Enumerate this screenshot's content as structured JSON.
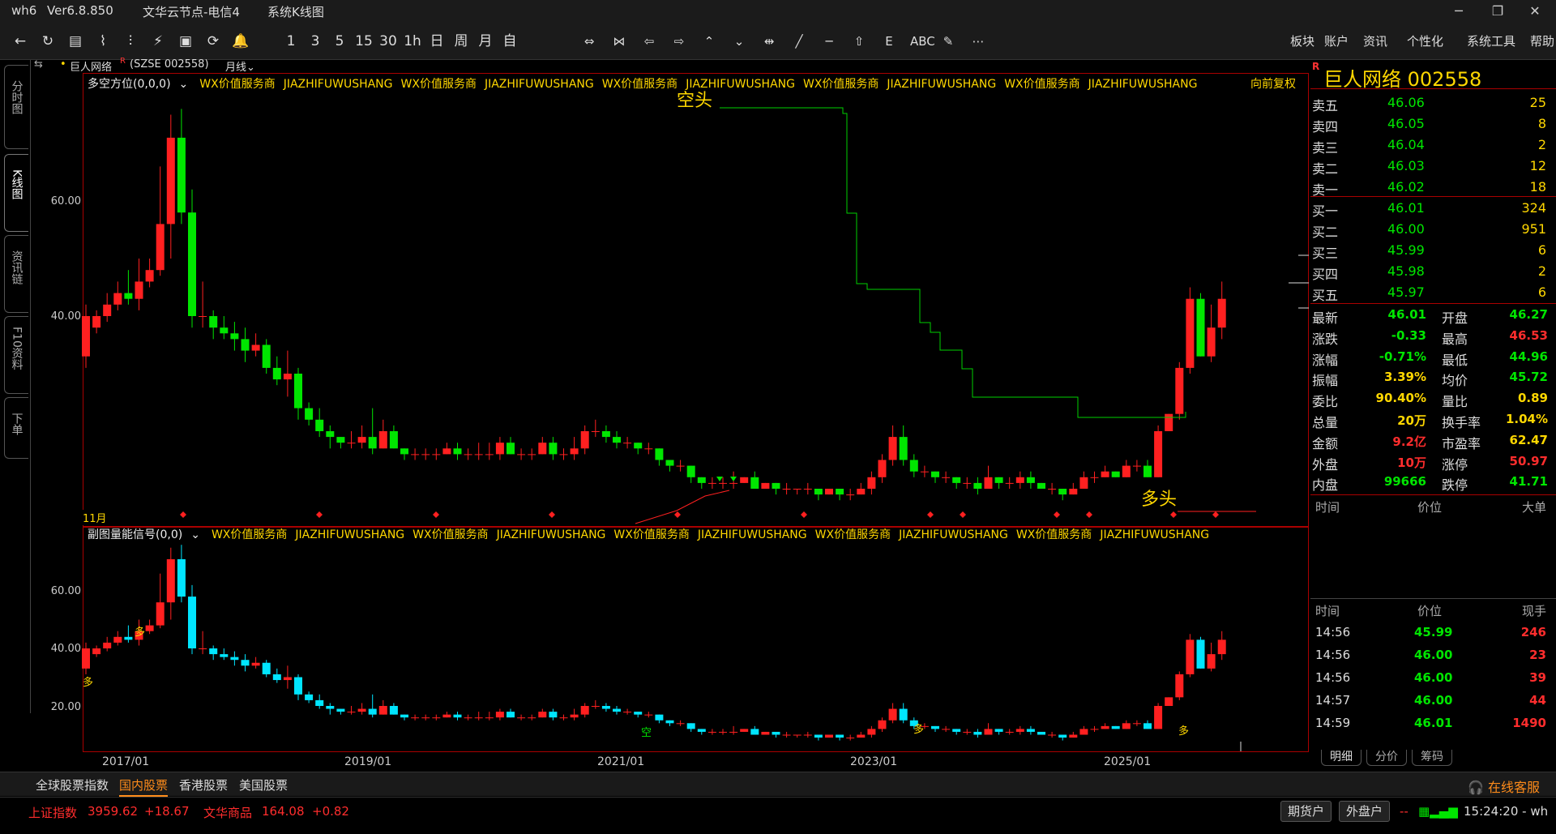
{
  "titlebar": {
    "app": "wh6",
    "version": "Ver6.8.850",
    "node": "文华云节点-电信4",
    "section": "系统K线图",
    "min": "─",
    "restore": "❐",
    "close": "✕"
  },
  "toolbar": {
    "icons": [
      "←",
      "↻",
      "▤",
      "⌇",
      "⫶",
      "⚡",
      "▣",
      "⟳",
      "🔔"
    ],
    "periods": [
      "1",
      "3",
      "5",
      "15",
      "30",
      "1h",
      "日",
      "周",
      "月",
      "自"
    ],
    "draw": [
      "⇔",
      "⋈",
      "⇦",
      "⇨",
      "⌃",
      "⌄",
      "⇹",
      "╱",
      "─",
      "⇧",
      "E",
      "ABC",
      "✎",
      "⋯"
    ],
    "menu": [
      "板块",
      "账户",
      "资讯",
      "个性化",
      "系统工具",
      "帮助"
    ]
  },
  "lefttabs": [
    "分时图",
    "K线图",
    "资讯链",
    "F10资料",
    "下单"
  ],
  "info": {
    "name": "巨人网络",
    "r": "R",
    "code": "(SZSE 002558)",
    "period": "月线"
  },
  "panel1": {
    "title": "多空方位(0,0,0)",
    "wx": [
      "WX价值服务商",
      "JIAZHIFUWUSHANG",
      "WX价值服务商",
      "JIAZHIFUWUSHANG",
      "WX价值服务商",
      "JIAZHIFUWUSHANG",
      "WX价值服务商",
      "JIAZHIFUWUSHANG",
      "WX价值服务商",
      "JIAZHIFUWUSHANG"
    ],
    "adjust": "向前复权",
    "short": "空头",
    "long": "多头",
    "month": "11月",
    "yticks": [
      "60.00",
      "40.00"
    ]
  },
  "panel2": {
    "title": "副图量能信号(0,0)",
    "wx": [
      "WX价值服务商",
      "JIAZHIFUWUSHANG",
      "WX价值服务商",
      "JIAZHIFUWUSHANG",
      "WX价值服务商",
      "JIAZHIFUWUSHANG",
      "WX价值服务商",
      "JIAZHIFUWUSHANG",
      "WX价值服务商",
      "JIAZHIFUWUSHANG"
    ],
    "yticks": [
      "60.00",
      "40.00",
      "20.00"
    ],
    "marks": [
      "多",
      "多",
      "空",
      "多",
      "多"
    ]
  },
  "xlabels": [
    "2017/01",
    "2019/01",
    "2021/01",
    "2023/01",
    "2025/01"
  ],
  "quote": {
    "name": "巨人网络",
    "code": "002558",
    "r": "R",
    "asks": [
      {
        "l": "卖五",
        "p": "46.06",
        "v": "25"
      },
      {
        "l": "卖四",
        "p": "46.05",
        "v": "8"
      },
      {
        "l": "卖三",
        "p": "46.04",
        "v": "2"
      },
      {
        "l": "卖二",
        "p": "46.03",
        "v": "12"
      },
      {
        "l": "卖一",
        "p": "46.02",
        "v": "18"
      }
    ],
    "bids": [
      {
        "l": "买一",
        "p": "46.01",
        "v": "324"
      },
      {
        "l": "买二",
        "p": "46.00",
        "v": "951"
      },
      {
        "l": "买三",
        "p": "45.99",
        "v": "6"
      },
      {
        "l": "买四",
        "p": "45.98",
        "v": "2"
      },
      {
        "l": "买五",
        "p": "45.97",
        "v": "6"
      }
    ],
    "stats": [
      {
        "a": "最新",
        "av": "46.01",
        "ac": "green",
        "b": "开盘",
        "bv": "46.27",
        "bc": "green"
      },
      {
        "a": "涨跌",
        "av": "-0.33",
        "ac": "green",
        "b": "最高",
        "bv": "46.53",
        "bc": "red"
      },
      {
        "a": "涨幅",
        "av": "-0.71%",
        "ac": "green",
        "b": "最低",
        "bv": "44.96",
        "bc": "green"
      },
      {
        "a": "振幅",
        "av": "3.39%",
        "ac": "yellow",
        "b": "均价",
        "bv": "45.72",
        "bc": "green"
      },
      {
        "a": "委比",
        "av": "90.40%",
        "ac": "yellow",
        "b": "量比",
        "bv": "0.89",
        "bc": "yellow"
      },
      {
        "a": "总量",
        "av": "20万",
        "ac": "yellow",
        "b": "换手率",
        "bv": "1.04%",
        "bc": "yellow"
      },
      {
        "a": "金额",
        "av": "9.2亿",
        "ac": "red",
        "b": "市盈率",
        "bv": "62.47",
        "bc": "yellow"
      },
      {
        "a": "外盘",
        "av": "10万",
        "ac": "red",
        "b": "涨停",
        "bv": "50.97",
        "bc": "red"
      },
      {
        "a": "内盘",
        "av": "99666",
        "ac": "green",
        "b": "跌停",
        "bv": "41.71",
        "bc": "green"
      }
    ],
    "h1": {
      "t": "时间",
      "p": "价位",
      "v": "大单"
    },
    "h2": {
      "t": "时间",
      "p": "价位",
      "v": "现手"
    },
    "ticks": [
      {
        "t": "14:56",
        "p": "45.99",
        "v": "246"
      },
      {
        "t": "14:56",
        "p": "46.00",
        "v": "23"
      },
      {
        "t": "14:56",
        "p": "46.00",
        "v": "39"
      },
      {
        "t": "14:57",
        "p": "46.00",
        "v": "44"
      },
      {
        "t": "14:59",
        "p": "46.01",
        "v": "1490"
      }
    ],
    "tabs": [
      "明细",
      "分价",
      "筹码"
    ]
  },
  "bottom": {
    "tabs": [
      "全球股票指数",
      "国内股票",
      "香港股票",
      "美国股票"
    ],
    "service": "在线客服"
  },
  "status": {
    "idx1": "上证指数",
    "idx1v": "3959.62",
    "idx1c": "+18.67",
    "idx2": "文华商品",
    "idx2v": "164.08",
    "idx2c": "+0.82",
    "b1": "期货户",
    "b2": "外盘户",
    "dash": "--",
    "time": "15:24:20 - wh"
  },
  "chart_data": {
    "type": "candlestick",
    "title": "巨人网络 (SZSE 002558) 月线",
    "ylim": [
      30,
      78
    ],
    "candles": [
      [
        33,
        40,
        31,
        42
      ],
      [
        38,
        40,
        37,
        41
      ],
      [
        40,
        42,
        39,
        44
      ],
      [
        42,
        44,
        41,
        46
      ],
      [
        44,
        43,
        42,
        48
      ],
      [
        43,
        46,
        41,
        50
      ],
      [
        46,
        48,
        45,
        50
      ],
      [
        48,
        56,
        47,
        66
      ],
      [
        56,
        71,
        50,
        75
      ],
      [
        71,
        58,
        56,
        76
      ],
      [
        58,
        40,
        38,
        62
      ],
      [
        40,
        40,
        38,
        46
      ],
      [
        40,
        38,
        36,
        41
      ],
      [
        38,
        37,
        36,
        40
      ],
      [
        37,
        36,
        34,
        39
      ],
      [
        36,
        34,
        32,
        38
      ],
      [
        34,
        35,
        33,
        37
      ],
      [
        35,
        31,
        30,
        36
      ],
      [
        31,
        29,
        28,
        33
      ],
      [
        29,
        30,
        26,
        34
      ],
      [
        30,
        24,
        22,
        31
      ],
      [
        24,
        22,
        21,
        25
      ],
      [
        22,
        20,
        19,
        24
      ],
      [
        20,
        19,
        17,
        21
      ],
      [
        19,
        18,
        17,
        19
      ],
      [
        18,
        18,
        17,
        20
      ],
      [
        18,
        19,
        17,
        21
      ],
      [
        19,
        17,
        16,
        24
      ],
      [
        17,
        20,
        17,
        22
      ],
      [
        20,
        17,
        17,
        21
      ],
      [
        17,
        16,
        15,
        17
      ],
      [
        16,
        16,
        15,
        17
      ],
      [
        16,
        16,
        15,
        17
      ],
      [
        16,
        16,
        15,
        17
      ],
      [
        16,
        17,
        16,
        18
      ],
      [
        17,
        16,
        15,
        18
      ],
      [
        16,
        16,
        15,
        17
      ],
      [
        16,
        16,
        15,
        18
      ],
      [
        16,
        16,
        15,
        18
      ],
      [
        16,
        18,
        15,
        19
      ],
      [
        18,
        16,
        16,
        19
      ],
      [
        16,
        16,
        15,
        17
      ],
      [
        16,
        16,
        15,
        17
      ],
      [
        16,
        18,
        16,
        19
      ],
      [
        18,
        16,
        15,
        19
      ],
      [
        16,
        16,
        15,
        17
      ],
      [
        16,
        17,
        15,
        19
      ],
      [
        17,
        20,
        16,
        21
      ],
      [
        20,
        20,
        19,
        22
      ],
      [
        20,
        19,
        18,
        21
      ],
      [
        19,
        18,
        17,
        20
      ],
      [
        18,
        18,
        17,
        19
      ],
      [
        18,
        17,
        16,
        18
      ],
      [
        17,
        17,
        16,
        18
      ],
      [
        17,
        15,
        14,
        17
      ],
      [
        15,
        14,
        13,
        15
      ],
      [
        14,
        14,
        13,
        15
      ],
      [
        14,
        12,
        11,
        14
      ],
      [
        12,
        11,
        10,
        12
      ],
      [
        11,
        11,
        10,
        12
      ],
      [
        11,
        11,
        10,
        12
      ],
      [
        11,
        11,
        10,
        13
      ],
      [
        11,
        12,
        11,
        12
      ],
      [
        12,
        10,
        10,
        13
      ],
      [
        10,
        11,
        10,
        11
      ],
      [
        11,
        10,
        9,
        11
      ],
      [
        10,
        10,
        9,
        11
      ],
      [
        10,
        10,
        9,
        10
      ],
      [
        10,
        10,
        9,
        11
      ],
      [
        10,
        9,
        8,
        10
      ],
      [
        9,
        10,
        9,
        10
      ],
      [
        10,
        9,
        8,
        10
      ],
      [
        9,
        9,
        8,
        10
      ],
      [
        9,
        10,
        9,
        11
      ],
      [
        10,
        12,
        9,
        13
      ],
      [
        12,
        15,
        11,
        16
      ],
      [
        15,
        19,
        14,
        21
      ],
      [
        19,
        15,
        14,
        21
      ],
      [
        15,
        13,
        12,
        16
      ],
      [
        13,
        13,
        12,
        14
      ],
      [
        13,
        12,
        11,
        13
      ],
      [
        12,
        12,
        11,
        13
      ],
      [
        12,
        11,
        10,
        12
      ],
      [
        11,
        11,
        10,
        12
      ],
      [
        11,
        10,
        9,
        12
      ],
      [
        10,
        12,
        10,
        14
      ],
      [
        12,
        11,
        10,
        12
      ],
      [
        11,
        11,
        10,
        12
      ],
      [
        11,
        12,
        10,
        13
      ],
      [
        12,
        11,
        10,
        13
      ],
      [
        11,
        10,
        10,
        11
      ],
      [
        10,
        10,
        9,
        11
      ],
      [
        10,
        9,
        8,
        10
      ],
      [
        9,
        10,
        9,
        11
      ],
      [
        10,
        12,
        10,
        13
      ],
      [
        12,
        12,
        11,
        13
      ],
      [
        12,
        13,
        12,
        14
      ],
      [
        13,
        12,
        12,
        13
      ],
      [
        12,
        14,
        12,
        15
      ],
      [
        14,
        14,
        13,
        15
      ],
      [
        14,
        12,
        12,
        15
      ],
      [
        12,
        20,
        12,
        21
      ],
      [
        20,
        23,
        20,
        23
      ],
      [
        23,
        31,
        22,
        32
      ],
      [
        31,
        43,
        30,
        45
      ],
      [
        43,
        33,
        33,
        44
      ],
      [
        33,
        38,
        32,
        42
      ],
      [
        38,
        43,
        36,
        46
      ]
    ]
  }
}
